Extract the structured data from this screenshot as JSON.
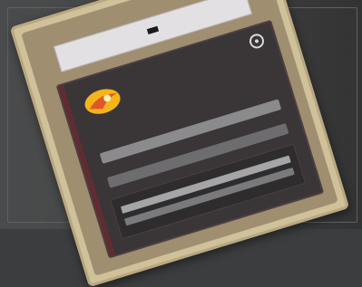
{
  "device": {
    "header": {
      "title": ""
    },
    "screen": {
      "brand": {
        "wordmark": ""
      },
      "rows": [
        {
          "label": ""
        },
        {
          "label": ""
        }
      ],
      "bottom_panel": {
        "rows": [
          {
            "label": ""
          },
          {
            "label": ""
          }
        ]
      }
    }
  },
  "icons": {
    "brand_logo": "logo-icon",
    "power": "power-icon"
  },
  "colors": {
    "body": "#cfc19a",
    "screen": "#3a3537",
    "header": "#e2e0e2",
    "accent": "#f3b51a",
    "accent_red": "#e0562a"
  }
}
